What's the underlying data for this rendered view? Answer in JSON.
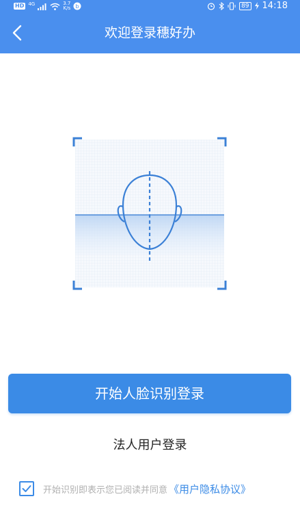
{
  "status_bar": {
    "hd_label": "HD",
    "network_label": "4G",
    "net_speed_value": "3.7",
    "net_speed_unit": "K/s",
    "battery_level": "89",
    "time": "14:18",
    "icons": [
      "signal-icon",
      "wifi-icon",
      "app-notification-icon",
      "alarm-icon",
      "bluetooth-icon",
      "vibrate-icon",
      "battery-icon",
      "charging-icon"
    ]
  },
  "header": {
    "title": "欢迎登录穗好办",
    "back_icon": "chevron-left-icon",
    "background_color": "#4a8fee"
  },
  "face_guide": {
    "icon": "face-outline-icon",
    "accent_color": "#3b80d6"
  },
  "actions": {
    "face_login_label": "开始人脸识别登录",
    "legal_person_login_label": "法人用户登录",
    "primary_color": "#3b8be6"
  },
  "agreement": {
    "checked": true,
    "prefix_text": "开始识别即表示您已阅读并同意",
    "link_text": "《用户隐私协议》"
  }
}
